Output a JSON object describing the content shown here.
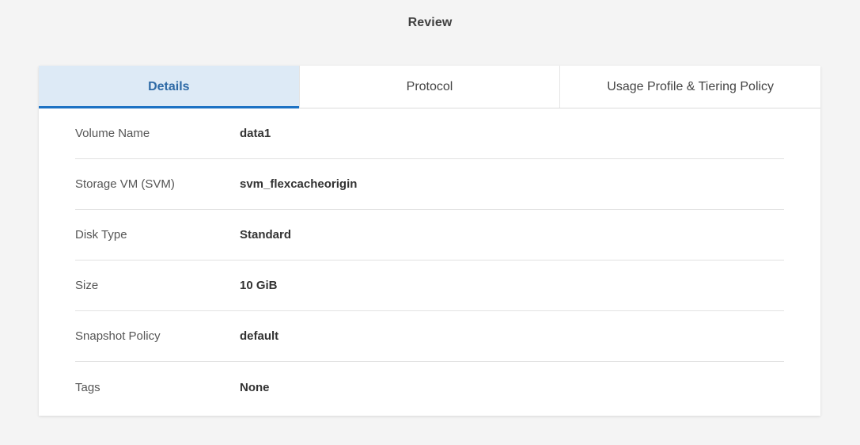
{
  "page": {
    "title": "Review"
  },
  "tabs": [
    {
      "label": "Details",
      "active": true
    },
    {
      "label": "Protocol",
      "active": false
    },
    {
      "label": "Usage Profile & Tiering Policy",
      "active": false
    }
  ],
  "details": {
    "rows": [
      {
        "label": "Volume Name",
        "value": "data1"
      },
      {
        "label": "Storage VM (SVM)",
        "value": "svm_flexcacheorigin"
      },
      {
        "label": "Disk Type",
        "value": "Standard"
      },
      {
        "label": "Size",
        "value": "10 GiB"
      },
      {
        "label": "Snapshot Policy",
        "value": "default"
      },
      {
        "label": "Tags",
        "value": "None"
      }
    ]
  },
  "colors": {
    "accent": "#1d72c4",
    "active_tab_bg": "#ddeaf6",
    "page_bg": "#f4f4f4"
  }
}
